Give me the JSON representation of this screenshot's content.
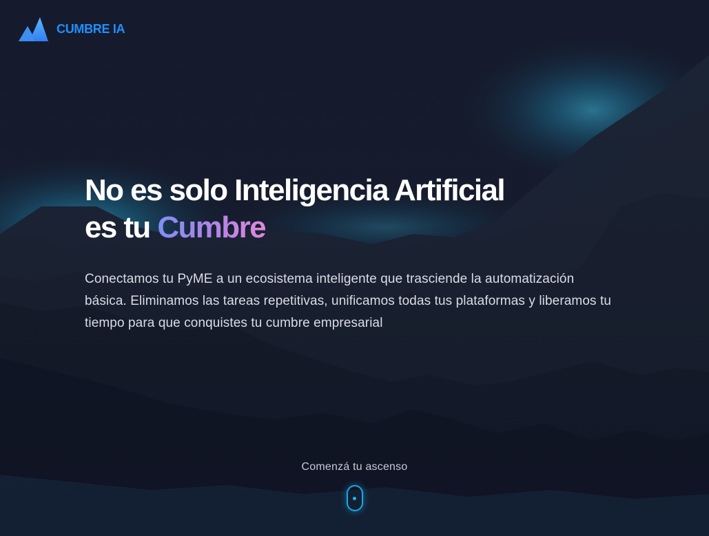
{
  "brand": {
    "name": "CUMBRE IA",
    "logo_icon": "mountain-icon",
    "color": "#1e90ff"
  },
  "hero": {
    "title_line1": "No es solo Inteligencia Artificial",
    "title_line2_prefix": "es tu",
    "title_line2_accent": "Cumbre",
    "description": "Conectamos tu PyME a un ecosistema inteligente que trasciende la automatización básica. Eliminamos las tareas repetitivas, unificamos todas tus plataformas y liberamos tu tiempo para que conquistes tu cumbre empresarial"
  },
  "cta": {
    "label": "Comenzá tu ascenso",
    "icon": "scroll-mouse-icon"
  },
  "colors": {
    "background": "#141a2b",
    "accent_gradient_start": "#7f8ff4",
    "accent_gradient_end": "#e089dc",
    "glow": "#19a8e6"
  }
}
